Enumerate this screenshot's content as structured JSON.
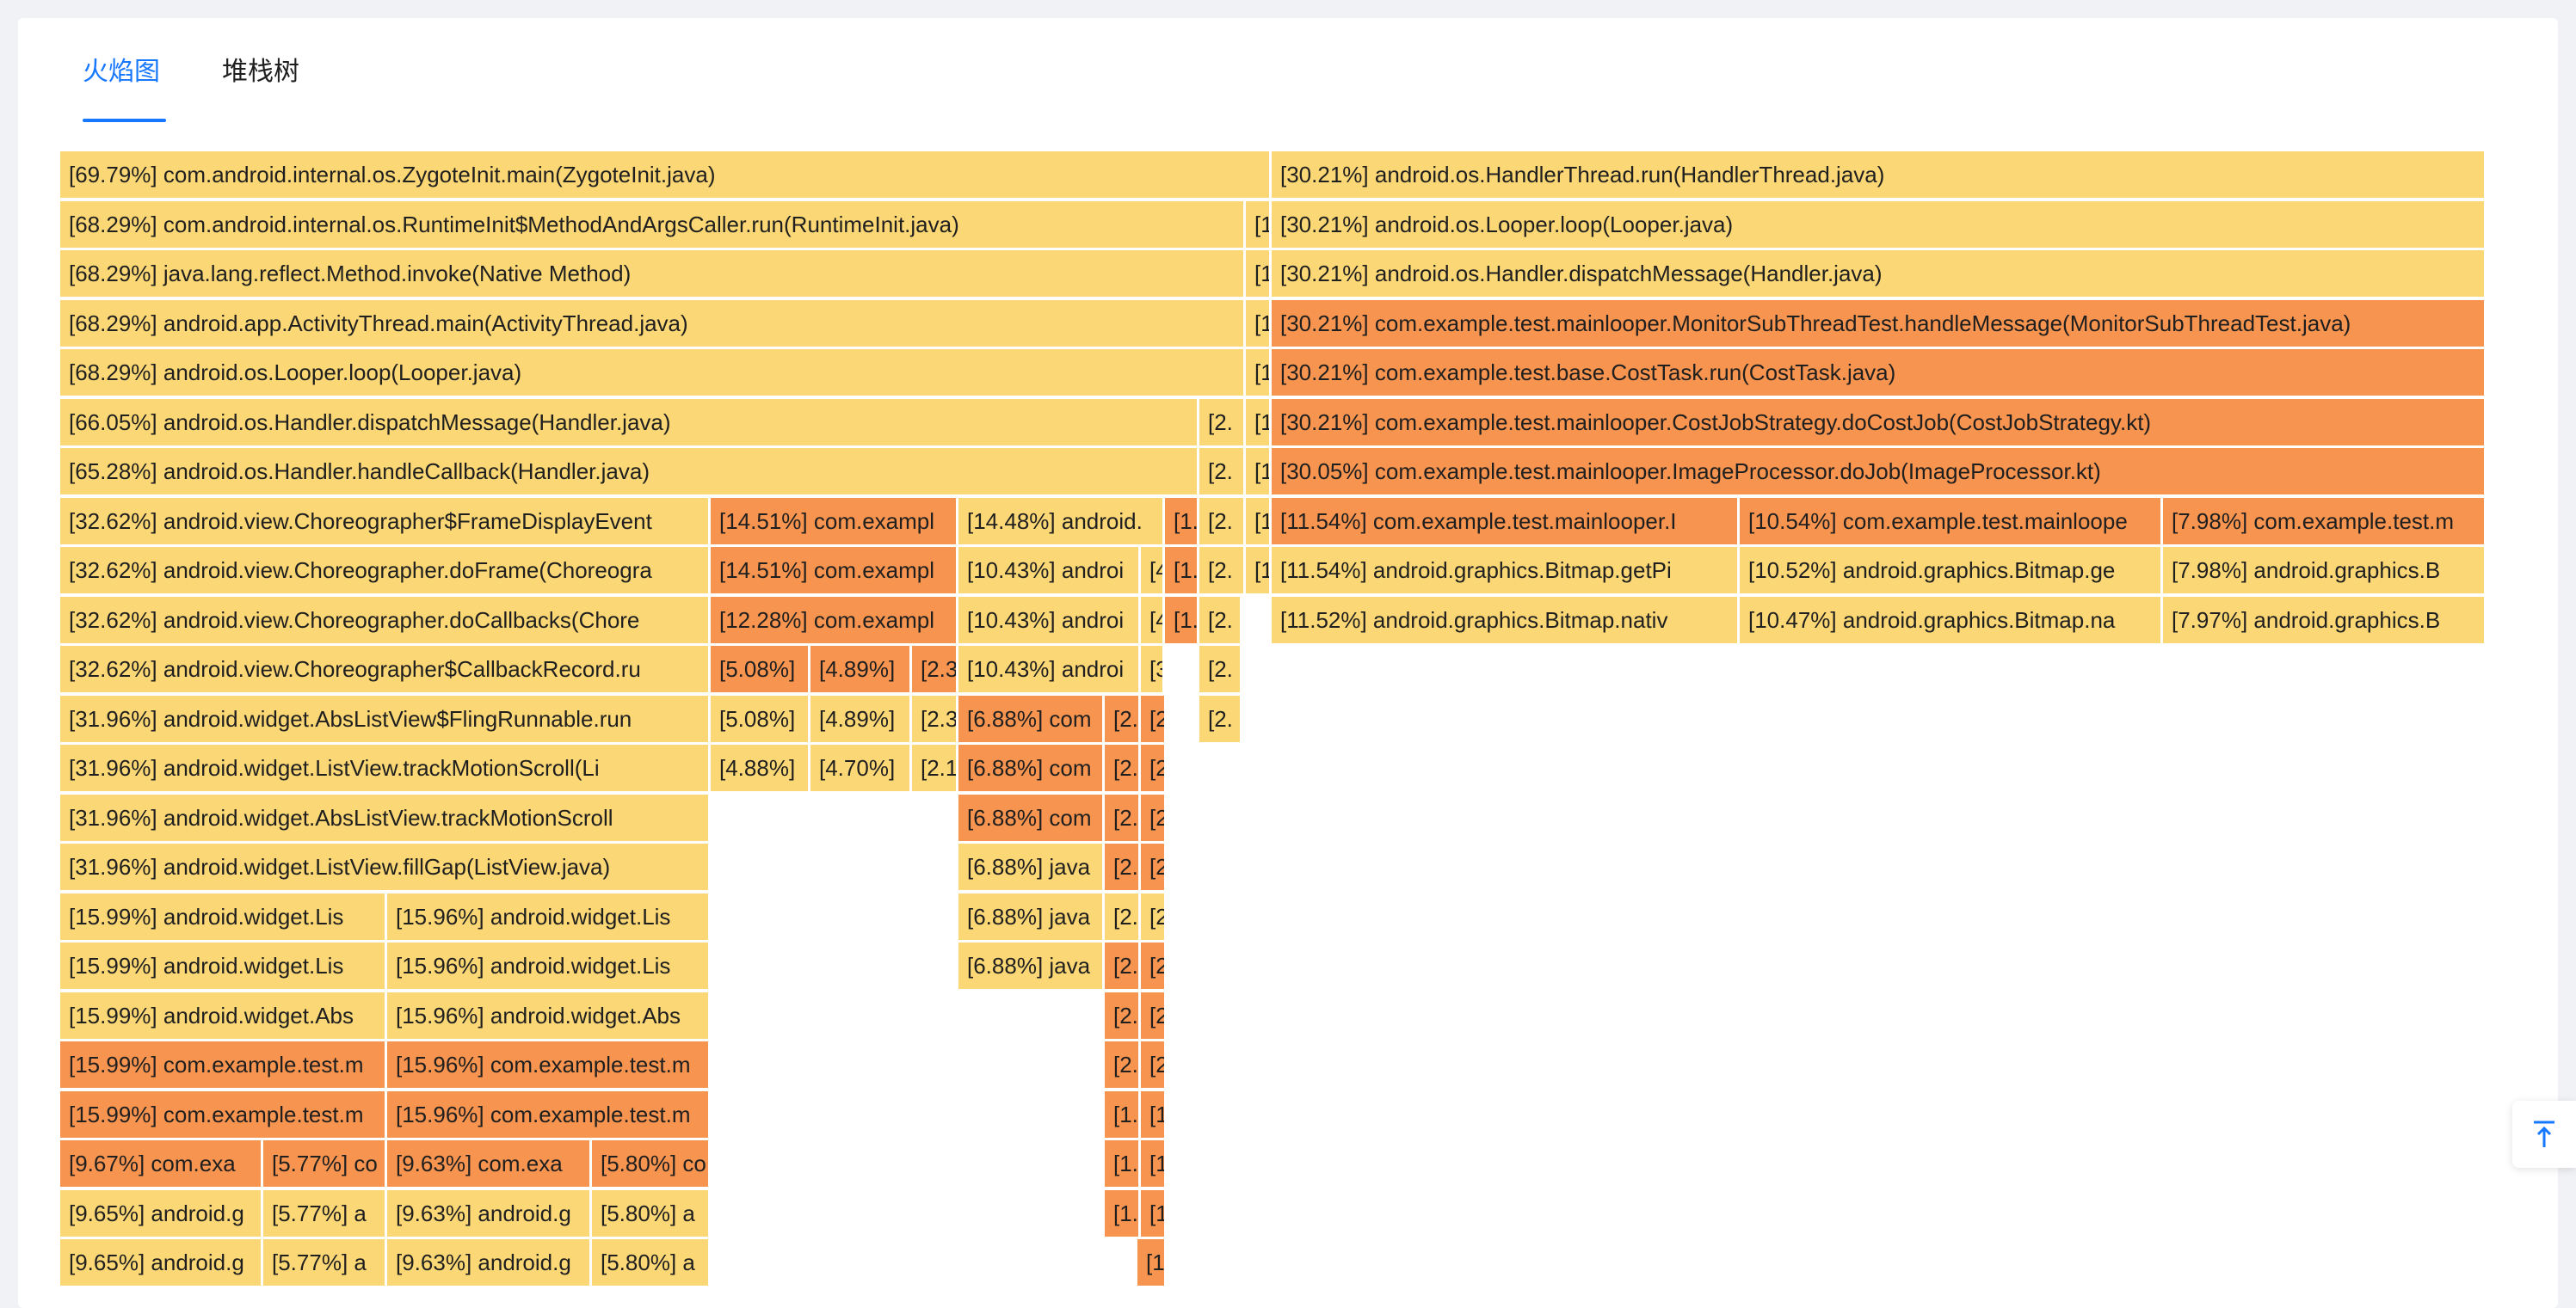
{
  "tabs": [
    {
      "label": "火焰图",
      "active": true
    },
    {
      "label": "堆栈树",
      "active": false
    }
  ],
  "colors": {
    "hot": "#f7944f",
    "warm": "#fbd775",
    "accent": "#1677ff"
  },
  "flame_graph": {
    "rows": [
      [
        {
          "text": "[69.79%] com.android.internal.os.ZygoteInit.main(ZygoteInit.java)",
          "s": "y"
        },
        {
          "text": "[30.21%] android.os.HandlerThread.run(HandlerThread.java)",
          "s": "y"
        }
      ],
      [
        {
          "text": "[68.29%] com.android.internal.os.RuntimeInit$MethodAndArgsCaller.run(RuntimeInit.java)",
          "s": "y"
        },
        {
          "text": "[1",
          "s": "y"
        },
        {
          "text": "[30.21%] android.os.Looper.loop(Looper.java)",
          "s": "y"
        }
      ],
      [
        {
          "text": "[68.29%] java.lang.reflect.Method.invoke(Native Method)",
          "s": "y"
        },
        {
          "text": "[1",
          "s": "y"
        },
        {
          "text": "[30.21%] android.os.Handler.dispatchMessage(Handler.java)",
          "s": "y"
        }
      ],
      [
        {
          "text": "[68.29%] android.app.ActivityThread.main(ActivityThread.java)",
          "s": "y"
        },
        {
          "text": "[1",
          "s": "y"
        },
        {
          "text": "[30.21%] com.example.test.mainlooper.MonitorSubThreadTest.handleMessage(MonitorSubThreadTest.java)",
          "s": "o"
        }
      ],
      [
        {
          "text": "[68.29%] android.os.Looper.loop(Looper.java)",
          "s": "y"
        },
        {
          "text": "[1",
          "s": "y"
        },
        {
          "text": "[30.21%] com.example.test.base.CostTask.run(CostTask.java)",
          "s": "o"
        }
      ],
      [
        {
          "text": "[66.05%] android.os.Handler.dispatchMessage(Handler.java)",
          "s": "y"
        },
        {
          "text": "[2.",
          "s": "y"
        },
        {
          "text": "[1",
          "s": "y"
        },
        {
          "text": "[30.21%] com.example.test.mainlooper.CostJobStrategy.doCostJob(CostJobStrategy.kt)",
          "s": "o"
        }
      ],
      [
        {
          "text": "[65.28%] android.os.Handler.handleCallback(Handler.java)",
          "s": "y"
        },
        {
          "text": "[2.",
          "s": "y"
        },
        {
          "text": "[1",
          "s": "y"
        },
        {
          "text": "[30.05%] com.example.test.mainlooper.ImageProcessor.doJob(ImageProcessor.kt)",
          "s": "o"
        }
      ],
      [
        {
          "text": "[32.62%] android.view.Choreographer$FrameDisplayEvent",
          "s": "y"
        },
        {
          "text": "[14.51%] com.exampl",
          "s": "o"
        },
        {
          "text": "[14.48%] android.",
          "s": "y"
        },
        {
          "text": "[1.",
          "s": "o"
        },
        {
          "text": "[2.",
          "s": "y"
        },
        {
          "text": "[1",
          "s": "y"
        },
        {
          "text": "[11.54%] com.example.test.mainlooper.I",
          "s": "o"
        },
        {
          "text": "[10.54%] com.example.test.mainloope",
          "s": "o"
        },
        {
          "text": "[7.98%] com.example.test.m",
          "s": "o"
        }
      ],
      [
        {
          "text": "[32.62%] android.view.Choreographer.doFrame(Choreogra",
          "s": "y"
        },
        {
          "text": "[14.51%] com.exampl",
          "s": "o"
        },
        {
          "text": "[10.43%] androi",
          "s": "y"
        },
        {
          "text": "[4",
          "s": "y"
        },
        {
          "text": "[1.",
          "s": "o"
        },
        {
          "text": "[2.",
          "s": "y"
        },
        {
          "text": "[1",
          "s": "y"
        },
        {
          "text": "[11.54%] android.graphics.Bitmap.getPi",
          "s": "y"
        },
        {
          "text": "[10.52%] android.graphics.Bitmap.ge",
          "s": "y"
        },
        {
          "text": "[7.98%] android.graphics.B",
          "s": "y"
        }
      ],
      [
        {
          "text": "[32.62%] android.view.Choreographer.doCallbacks(Chore",
          "s": "y"
        },
        {
          "text": "[12.28%] com.exampl",
          "s": "o"
        },
        {
          "text": "[10.43%] androi",
          "s": "y"
        },
        {
          "text": "[4",
          "s": "y"
        },
        {
          "text": "[1.",
          "s": "o"
        },
        {
          "text": "[2.",
          "s": "y"
        },
        {
          "text": "[11.52%] android.graphics.Bitmap.nativ",
          "s": "y"
        },
        {
          "text": "[10.47%] android.graphics.Bitmap.na",
          "s": "y"
        },
        {
          "text": "[7.97%] android.graphics.B",
          "s": "y"
        }
      ],
      [
        {
          "text": "[32.62%] android.view.Choreographer$CallbackRecord.ru",
          "s": "y"
        },
        {
          "text": "[5.08%]",
          "s": "o"
        },
        {
          "text": "[4.89%]",
          "s": "o"
        },
        {
          "text": "[2.3",
          "s": "o"
        },
        {
          "text": "[10.43%] androi",
          "s": "y"
        },
        {
          "text": "[3",
          "s": "y"
        },
        {
          "text": "[2.",
          "s": "y"
        }
      ],
      [
        {
          "text": "[31.96%] android.widget.AbsListView$FlingRunnable.run",
          "s": "y"
        },
        {
          "text": "[5.08%]",
          "s": "y"
        },
        {
          "text": "[4.89%]",
          "s": "y"
        },
        {
          "text": "[2.3",
          "s": "y"
        },
        {
          "text": "[6.88%] com",
          "s": "o"
        },
        {
          "text": "[2.",
          "s": "o"
        },
        {
          "text": "[2",
          "s": "o"
        },
        {
          "text": "[2.",
          "s": "y"
        }
      ],
      [
        {
          "text": "[31.96%] android.widget.ListView.trackMotionScroll(Li",
          "s": "y"
        },
        {
          "text": "[4.88%]",
          "s": "y"
        },
        {
          "text": "[4.70%]",
          "s": "y"
        },
        {
          "text": "[2.1",
          "s": "y"
        },
        {
          "text": "[6.88%] com",
          "s": "o"
        },
        {
          "text": "[2.",
          "s": "o"
        },
        {
          "text": "[2",
          "s": "o"
        }
      ],
      [
        {
          "text": "[31.96%] android.widget.AbsListView.trackMotionScroll",
          "s": "y"
        },
        {
          "text": "[6.88%] com",
          "s": "o"
        },
        {
          "text": "[2.",
          "s": "o"
        },
        {
          "text": "[2",
          "s": "o"
        }
      ],
      [
        {
          "text": "[31.96%] android.widget.ListView.fillGap(ListView.java)",
          "s": "y"
        },
        {
          "text": "[6.88%] java",
          "s": "y"
        },
        {
          "text": "[2.",
          "s": "o"
        },
        {
          "text": "[2",
          "s": "o"
        }
      ],
      [
        {
          "text": "[15.99%] android.widget.Lis",
          "s": "y"
        },
        {
          "text": "[15.96%] android.widget.Lis",
          "s": "y"
        },
        {
          "text": "[6.88%] java",
          "s": "y"
        },
        {
          "text": "[2.",
          "s": "y"
        },
        {
          "text": "[2",
          "s": "y"
        }
      ],
      [
        {
          "text": "[15.99%] android.widget.Lis",
          "s": "y"
        },
        {
          "text": "[15.96%] android.widget.Lis",
          "s": "y"
        },
        {
          "text": "[6.88%] java",
          "s": "y"
        },
        {
          "text": "[2.",
          "s": "o"
        },
        {
          "text": "[2",
          "s": "o"
        }
      ],
      [
        {
          "text": "[15.99%] android.widget.Abs",
          "s": "y"
        },
        {
          "text": "[15.96%] android.widget.Abs",
          "s": "y"
        },
        {
          "text": "[2.",
          "s": "o"
        },
        {
          "text": "[2",
          "s": "o"
        }
      ],
      [
        {
          "text": "[15.99%] com.example.test.m",
          "s": "o"
        },
        {
          "text": "[15.96%] com.example.test.m",
          "s": "o"
        },
        {
          "text": "[2.",
          "s": "o"
        },
        {
          "text": "[2",
          "s": "o"
        }
      ],
      [
        {
          "text": "[15.99%] com.example.test.m",
          "s": "o"
        },
        {
          "text": "[15.96%] com.example.test.m",
          "s": "o"
        },
        {
          "text": "[1.",
          "s": "o"
        },
        {
          "text": "[1",
          "s": "o"
        }
      ],
      [
        {
          "text": "[9.67%] com.exa",
          "s": "o"
        },
        {
          "text": "[5.77%] co",
          "s": "o"
        },
        {
          "text": "[9.63%] com.exa",
          "s": "o"
        },
        {
          "text": "[5.80%] co",
          "s": "o"
        },
        {
          "text": "[1.",
          "s": "o"
        },
        {
          "text": "[1",
          "s": "o"
        }
      ],
      [
        {
          "text": "[9.65%] android.g",
          "s": "y"
        },
        {
          "text": "[5.77%] a",
          "s": "y"
        },
        {
          "text": "[9.63%] android.g",
          "s": "y"
        },
        {
          "text": "[5.80%] a",
          "s": "y"
        },
        {
          "text": "[1.",
          "s": "o"
        },
        {
          "text": "[1",
          "s": "o"
        }
      ],
      [
        {
          "text": "[9.65%] android.g",
          "s": "y"
        },
        {
          "text": "[5.77%] a",
          "s": "y"
        },
        {
          "text": "[9.63%] android.g",
          "s": "y"
        },
        {
          "text": "[5.80%] a",
          "s": "y"
        },
        {
          "text": "[1",
          "s": "o"
        }
      ]
    ]
  },
  "back_to_top": {
    "icon": "arrow-up-to-line-icon"
  }
}
